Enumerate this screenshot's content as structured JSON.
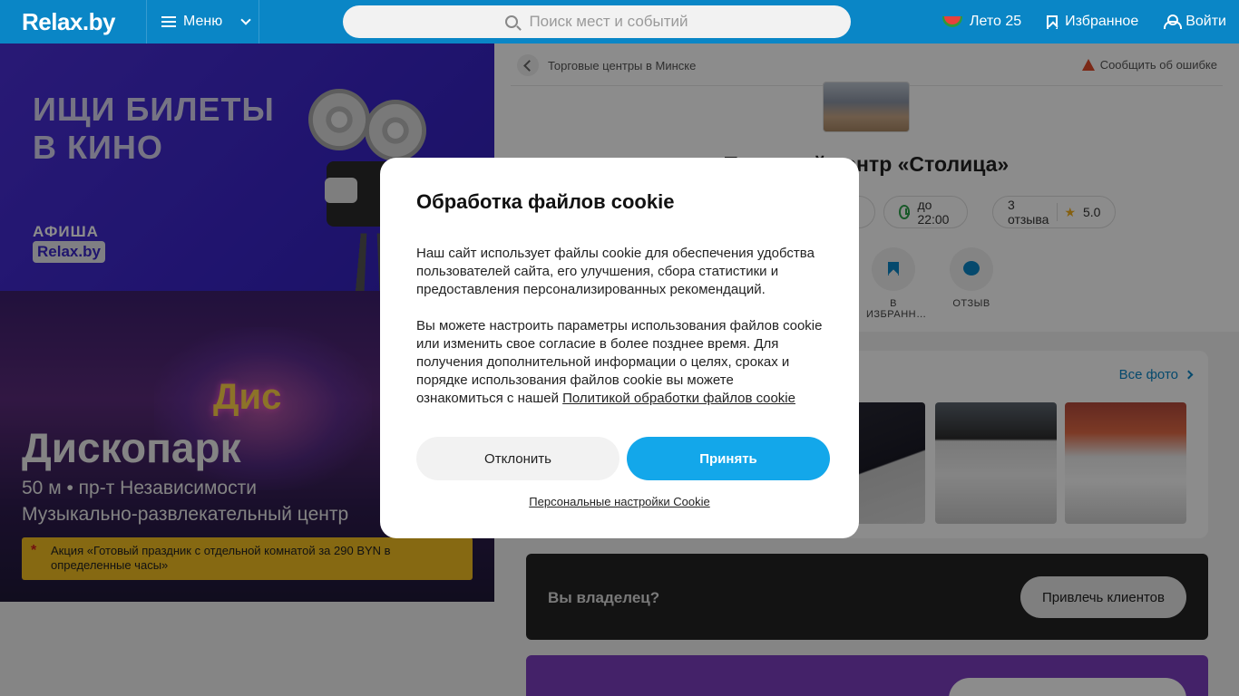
{
  "header": {
    "logo": "Relax.by",
    "menu_label": "Меню",
    "search_placeholder": "Поиск мест и событий",
    "summer_label": "Лето 25",
    "favorites_label": "Избранное",
    "login_label": "Войти"
  },
  "left": {
    "banner1": {
      "title_line1": "ИЩИ БИЛЕТЫ",
      "title_line2": "В КИНО",
      "brand_top": "АФИША",
      "brand_logo": "Relax.by"
    },
    "banner2": {
      "sign_text": "Дис",
      "title": "Дископарк",
      "subtitle1": "50 м • пр-т Независимости",
      "subtitle2": "Музыкально-развлекательный центр",
      "promo": "Акция «Готовый праздник с отдельной комнатой за 290 BYN в определенные часы»"
    }
  },
  "right": {
    "breadcrumb": "Торговые центры в Минске",
    "report_label": "Сообщить об ошибке",
    "venue_title": "Торговый центр «Столица»",
    "hours": "до 22:00",
    "reviews": "3 отзыва",
    "rating": "5.0",
    "actions": [
      {
        "label": "В ИЗБРАНН…"
      },
      {
        "label": "ОТЗЫВ"
      }
    ],
    "all_photos_label": "Все фото",
    "owner_question": "Вы владелец?",
    "owner_button": "Привлечь клиентов"
  },
  "cookie_modal": {
    "title": "Обработка файлов cookie",
    "paragraph1": "Наш сайт использует файлы cookie для обеспечения удобства пользователей сайта, его улучшения, сбора статистики и предоставления персонализированных рекомендаций.",
    "paragraph2": "Вы можете настроить параметры использования файлов cookie или изменить свое согласие в более позднее время. Для получения дополнительной информации о целях, сроках и порядке использования файлов cookie вы можете ознакомиться с нашей",
    "policy_link": "Политикой обработки файлов cookie",
    "decline_label": "Отклонить",
    "accept_label": "Принять",
    "settings_link": "Персональные настройки Cookie"
  },
  "colors": {
    "header_bg": "#0a86c6",
    "accept_bg": "#13a7ea",
    "promo_bg": "#f4c021"
  }
}
